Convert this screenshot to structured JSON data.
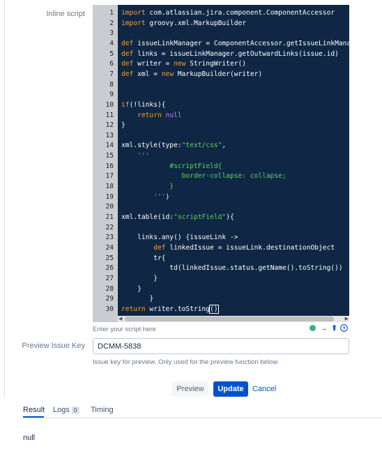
{
  "form": {
    "inline_script_label": "Inline script",
    "script_hint": "Enter your script here",
    "preview_key_label": "Preview Issue Key",
    "preview_key_value": "DCMM-5838",
    "preview_key_hint": "Issue key for preview. Only used for the preview function below."
  },
  "editor": {
    "lines": [
      {
        "n": "1",
        "segs": [
          [
            "kw",
            "import"
          ],
          [
            "txt",
            " com.atlassian.jira.component.ComponentAccessor"
          ]
        ]
      },
      {
        "n": "2",
        "segs": [
          [
            "kw",
            "import"
          ],
          [
            "txt",
            " groovy.xml.MarkupBuilder"
          ]
        ]
      },
      {
        "n": "3",
        "segs": []
      },
      {
        "n": "4",
        "segs": [
          [
            "kw",
            "def"
          ],
          [
            "txt",
            " issueLinkManager = ComponentAccessor.getIssueLinkManager()"
          ]
        ]
      },
      {
        "n": "5",
        "segs": [
          [
            "kw",
            "def"
          ],
          [
            "txt",
            " links = issueLinkManager.getOutwardLinks(issue.id)"
          ]
        ]
      },
      {
        "n": "6",
        "segs": [
          [
            "kw",
            "def"
          ],
          [
            "txt",
            " writer = "
          ],
          [
            "kw",
            "new"
          ],
          [
            "txt",
            " StringWriter()"
          ]
        ]
      },
      {
        "n": "7",
        "segs": [
          [
            "kw",
            "def"
          ],
          [
            "txt",
            " xml = "
          ],
          [
            "kw",
            "new"
          ],
          [
            "txt",
            " MarkupBuilder(writer)"
          ]
        ]
      },
      {
        "n": "8",
        "segs": []
      },
      {
        "n": "9",
        "segs": []
      },
      {
        "n": "10",
        "segs": [
          [
            "kw",
            "if"
          ],
          [
            "txt",
            "(!links){"
          ]
        ]
      },
      {
        "n": "11",
        "segs": [
          [
            "txt",
            "    "
          ],
          [
            "kw",
            "return"
          ],
          [
            "txt",
            " "
          ],
          [
            "nul",
            "null"
          ]
        ]
      },
      {
        "n": "12",
        "segs": [
          [
            "txt",
            "}"
          ]
        ]
      },
      {
        "n": "13",
        "segs": []
      },
      {
        "n": "14",
        "segs": [
          [
            "txt",
            "xml.style(type:"
          ],
          [
            "str",
            "\"text/css\""
          ],
          [
            "txt",
            ","
          ]
        ]
      },
      {
        "n": "15",
        "segs": [
          [
            "str",
            "    '''"
          ]
        ]
      },
      {
        "n": "16",
        "segs": [
          [
            "str",
            "            #scriptField{"
          ]
        ]
      },
      {
        "n": "17",
        "segs": [
          [
            "str",
            "               border-collapse: collapse;"
          ]
        ]
      },
      {
        "n": "18",
        "segs": [
          [
            "str",
            "            }"
          ]
        ]
      },
      {
        "n": "19",
        "segs": [
          [
            "str",
            "        '''"
          ],
          [
            "txt",
            ")"
          ]
        ]
      },
      {
        "n": "20",
        "segs": []
      },
      {
        "n": "21",
        "segs": [
          [
            "txt",
            "xml.table(id:"
          ],
          [
            "str",
            "\"scriptField\""
          ],
          [
            "txt",
            "){"
          ]
        ]
      },
      {
        "n": "22",
        "segs": []
      },
      {
        "n": "23",
        "segs": [
          [
            "txt",
            "    links.any() {issueLink ->"
          ]
        ]
      },
      {
        "n": "24",
        "segs": [
          [
            "txt",
            "        "
          ],
          [
            "kw",
            "def"
          ],
          [
            "txt",
            " linkedIssue = issueLink.destinationObject"
          ]
        ]
      },
      {
        "n": "25",
        "segs": [
          [
            "txt",
            "        tr{"
          ]
        ]
      },
      {
        "n": "26",
        "segs": [
          [
            "txt",
            "            td(linkedIssue.status.getName().toString())"
          ]
        ]
      },
      {
        "n": "27",
        "segs": [
          [
            "txt",
            "        }"
          ]
        ]
      },
      {
        "n": "28",
        "segs": [
          [
            "txt",
            "    }"
          ]
        ]
      },
      {
        "n": "29",
        "segs": [
          [
            "txt",
            "       }"
          ]
        ]
      },
      {
        "n": "30",
        "segs": [
          [
            "kw",
            "return"
          ],
          [
            "txt",
            " writer.toString"
          ],
          [
            "cursor",
            "()"
          ]
        ]
      }
    ]
  },
  "actions": {
    "preview_label": "Preview",
    "update_label": "Update",
    "cancel_label": "Cancel"
  },
  "tabs": {
    "result_label": "Result",
    "logs_label": "Logs",
    "logs_count": "0",
    "timing_label": "Timing"
  },
  "result": {
    "value": "null"
  },
  "icons": {
    "status": "green-dot-icon",
    "move_right": "arrow-right-icon",
    "move_up": "arrow-up-icon",
    "help": "help-icon"
  },
  "colors": {
    "accent": "#0052cc",
    "status_ok": "#36b37e"
  }
}
